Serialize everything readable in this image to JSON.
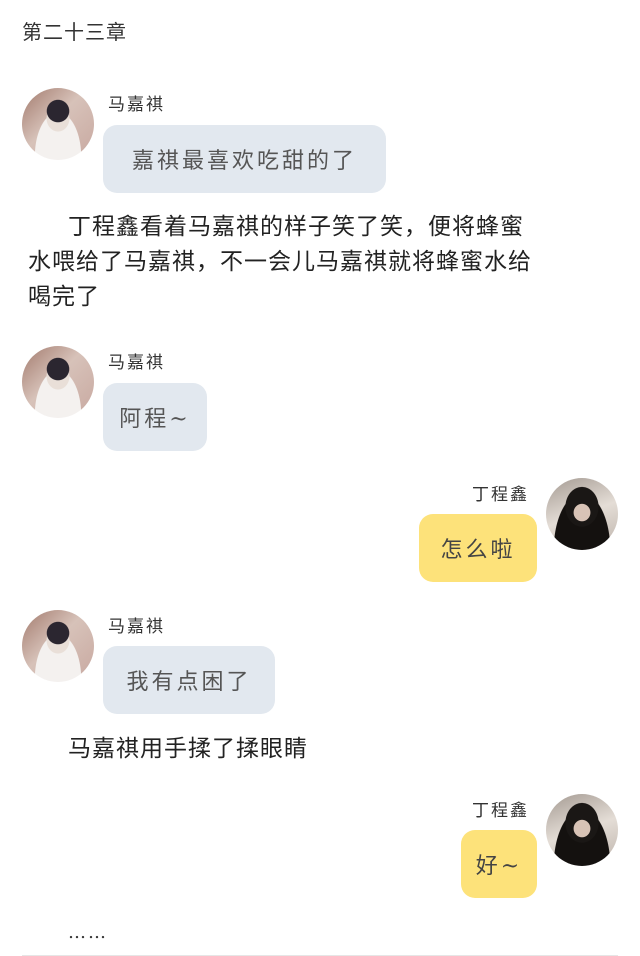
{
  "chapter_title": "第二十三章",
  "messages": [
    {
      "sender": "马嘉祺",
      "text": "嘉祺最喜欢吃甜的了",
      "avatar": "boy-white-shirt-avatar"
    },
    {
      "sender": "马嘉祺",
      "text": "阿程~",
      "avatar": "boy-white-shirt-avatar"
    },
    {
      "sender": "丁程鑫",
      "text": "怎么啦",
      "avatar": "boy-dark-hood-avatar"
    },
    {
      "sender": "马嘉祺",
      "text": "我有点困了",
      "avatar": "boy-white-shirt-avatar"
    },
    {
      "sender": "丁程鑫",
      "text": "好~",
      "avatar": "boy-dark-hood-avatar"
    }
  ],
  "narration": [
    {
      "lines": [
        "丁程鑫看着马嘉祺的样子笑了笑，便将蜂蜜",
        "水喂给了马嘉祺，不一会儿马嘉祺就将蜂蜜水给",
        "喝完了"
      ]
    },
    {
      "lines": [
        "马嘉祺用手揉了揉眼睛"
      ]
    }
  ],
  "ellipsis": "……",
  "colors": {
    "left_bubble": "#e2e8ef",
    "right_bubble": "#fde27a"
  }
}
